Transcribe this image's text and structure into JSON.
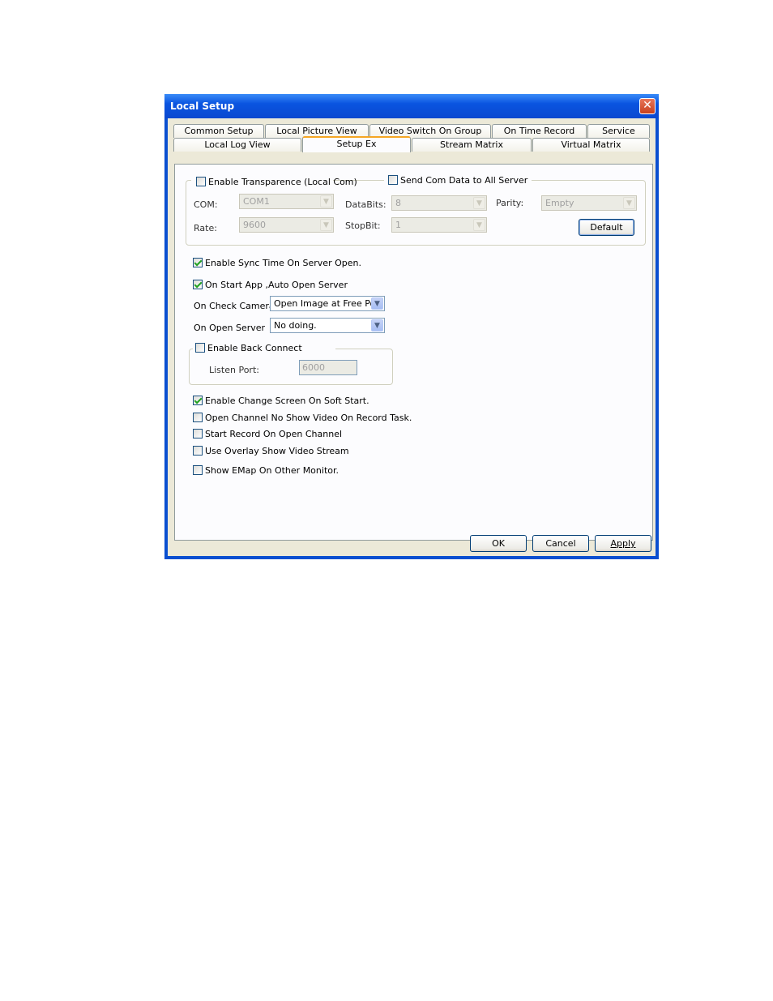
{
  "window": {
    "title": "Local Setup"
  },
  "tabs_row1": [
    "Common Setup",
    "Local Picture View",
    "Video Switch On Group",
    "On Time Record",
    "Service"
  ],
  "tabs_row2": [
    "Local Log View",
    "Setup Ex",
    "Stream Matrix",
    "Virtual Matrix"
  ],
  "active_tab": "Setup Ex",
  "com_group": {
    "enable_transparence": "Enable Transparence (Local Com)",
    "send_com_data": "Send Com Data to All Server",
    "com_label": "COM:",
    "com_value": "COM1",
    "databits_label": "DataBits:",
    "databits_value": "8",
    "parity_label": "Parity:",
    "parity_value": "Empty",
    "rate_label": "Rate:",
    "rate_value": "9600",
    "stopbit_label": "StopBit:",
    "stopbit_value": "1",
    "default_button": "Default"
  },
  "options": {
    "sync_time": "Enable Sync Time On Server Open.",
    "auto_open": "On Start App ,Auto Open Server",
    "on_check_camera_label": "On Check Camera",
    "on_check_camera_value": "Open Image at Free Pos",
    "on_open_server_label": "On Open Server",
    "on_open_server_value": "No doing.",
    "back_connect": "Enable Back Connect",
    "listen_port_label": "Listen Port:",
    "listen_port_value": "6000",
    "change_screen": "Enable Change Screen On Soft Start.",
    "no_show_video": "Open Channel No Show Video On Record Task.",
    "start_record": "Start Record On Open Channel",
    "use_overlay": "Use Overlay Show Video Stream",
    "show_emap": "Show EMap On Other Monitor."
  },
  "buttons": {
    "ok": "OK",
    "cancel": "Cancel",
    "apply": "Apply"
  },
  "colors": {
    "title_bar": "#0a54e0",
    "face": "#ece9d8",
    "tab_highlight": "#f5a623",
    "check": "#21a121"
  }
}
